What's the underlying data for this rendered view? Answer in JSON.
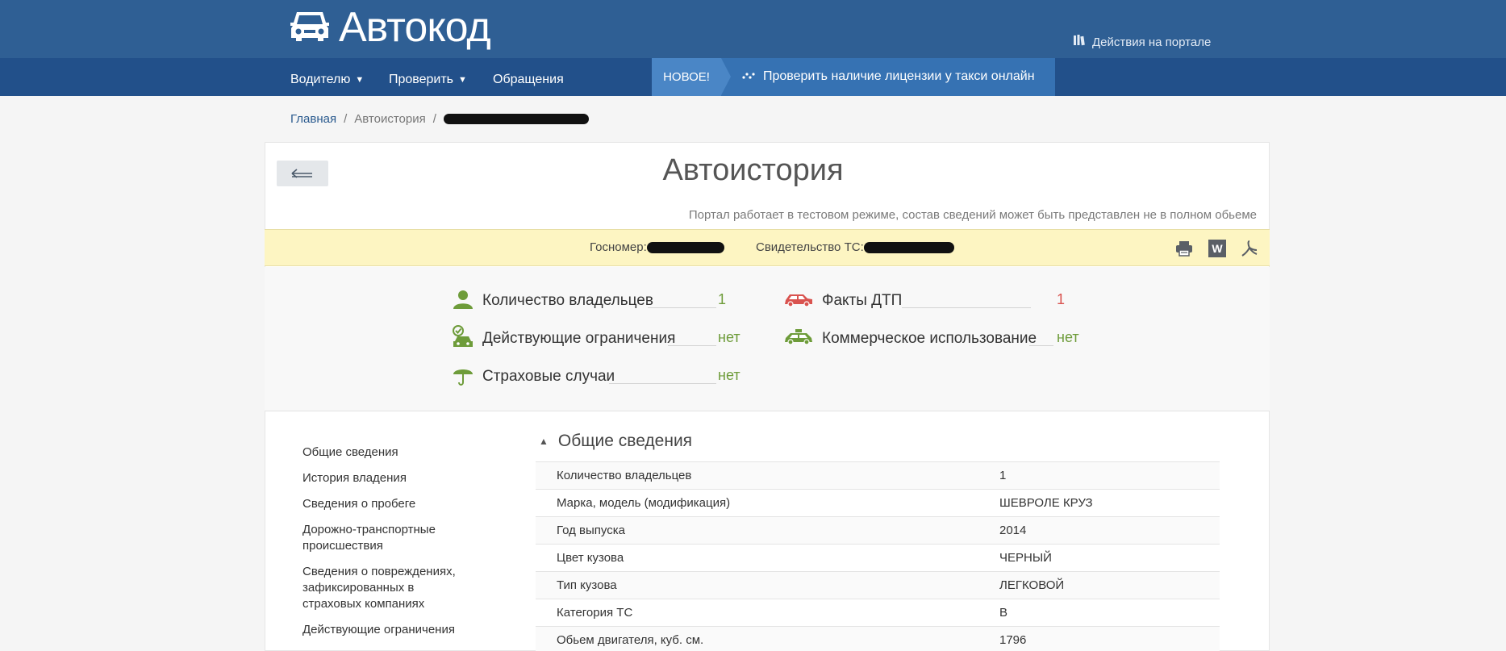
{
  "header": {
    "logo_text": "Автокод",
    "portal_actions": "Действия на портале",
    "nav": [
      {
        "label": "Водителю",
        "has_caret": true
      },
      {
        "label": "Проверить",
        "has_caret": true
      },
      {
        "label": "Обращения",
        "has_caret": false
      }
    ],
    "new_badge": "НОВОЕ!",
    "new_link": "Проверить наличие лицензии у такси онлайн"
  },
  "breadcrumb": {
    "home": "Главная",
    "sep": "/",
    "current": "Автоистория"
  },
  "page": {
    "title": "Автоистория",
    "notice": "Портал работает в тестовом режиме, состав сведений может быть представлен не в полном обьеме"
  },
  "plate_bar": {
    "gosnomer_label": "Госномер:",
    "svid_label": "Свидетельство ТС:"
  },
  "summary": {
    "owners": {
      "label": "Количество владельцев",
      "value": "1"
    },
    "restrictions": {
      "label": "Действующие ограничения",
      "value": "нет"
    },
    "insurance": {
      "label": "Страховые случаи",
      "value": "нет"
    },
    "accidents": {
      "label": "Факты ДТП",
      "value": "1"
    },
    "commercial": {
      "label": "Коммерческое использование",
      "value": "нет"
    }
  },
  "colors": {
    "header_top": "#2f5f94",
    "header_nav": "#22508a",
    "new_badge": "#4a86c6",
    "green": "#6e9c3a",
    "red": "#d9534f",
    "plate_bar": "#fdf5c2"
  },
  "sidebar": [
    "Общие сведения",
    "История владения",
    "Сведения о пробеге",
    "Дорожно-транспортные происшествия",
    "Сведения о повреждениях, зафиксированных в страховых компаниях",
    "Действующие ограничения"
  ],
  "details": {
    "title": "Общие сведения",
    "rows": [
      {
        "key": "Количество владельцев",
        "value": "1"
      },
      {
        "key": "Марка, модель (модификация)",
        "value": "ШЕВРОЛЕ КРУЗ"
      },
      {
        "key": "Год выпуска",
        "value": "2014"
      },
      {
        "key": "Цвет кузова",
        "value": "ЧЕРНЫЙ"
      },
      {
        "key": "Тип кузова",
        "value": "ЛЕГКОВОЙ"
      },
      {
        "key": "Категория ТС",
        "value": "B"
      },
      {
        "key": "Обьем двигателя, куб. см.",
        "value": "1796"
      }
    ]
  }
}
